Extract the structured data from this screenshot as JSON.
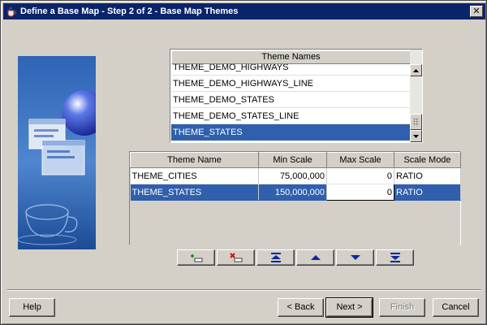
{
  "window": {
    "title": "Define a Base Map - Step 2 of 2 - Base Map Themes",
    "icon": "java-cup-icon",
    "close_glyph": "✕"
  },
  "theme_names": {
    "header": "Theme Names",
    "items": [
      {
        "label": "THEME_DEMO_HIGHWAYS",
        "selected": false
      },
      {
        "label": "THEME_DEMO_HIGHWAYS_LINE",
        "selected": false
      },
      {
        "label": "THEME_DEMO_STATES",
        "selected": false
      },
      {
        "label": "THEME_DEMO_STATES_LINE",
        "selected": false
      },
      {
        "label": "THEME_STATES",
        "selected": true
      }
    ]
  },
  "themes_table": {
    "columns": [
      "Theme Name",
      "Min Scale",
      "Max Scale",
      "Scale Mode"
    ],
    "rows": [
      {
        "theme_name": "THEME_CITIES",
        "min_scale": "75,000,000",
        "max_scale": "0",
        "scale_mode": "RATIO",
        "selected": false
      },
      {
        "theme_name": "THEME_STATES",
        "min_scale": "150,000,000",
        "max_scale": "0",
        "scale_mode": "RATIO",
        "selected": true
      }
    ]
  },
  "toolbar": {
    "buttons": [
      {
        "name": "add-theme-button",
        "icon": "add-row-icon"
      },
      {
        "name": "remove-theme-button",
        "icon": "remove-row-icon"
      },
      {
        "name": "move-to-top-button",
        "icon": "move-top-icon"
      },
      {
        "name": "move-up-button",
        "icon": "move-up-icon"
      },
      {
        "name": "move-down-button",
        "icon": "move-down-icon"
      },
      {
        "name": "move-to-bottom-button",
        "icon": "move-bottom-icon"
      }
    ]
  },
  "buttons": {
    "help": "Help",
    "back": "< Back",
    "next": "Next >",
    "finish": "Finish",
    "cancel": "Cancel"
  },
  "colors": {
    "titlebar": "#0a246a",
    "selection": "#2f5fad",
    "dialog_bg": "#d4d0c8"
  }
}
